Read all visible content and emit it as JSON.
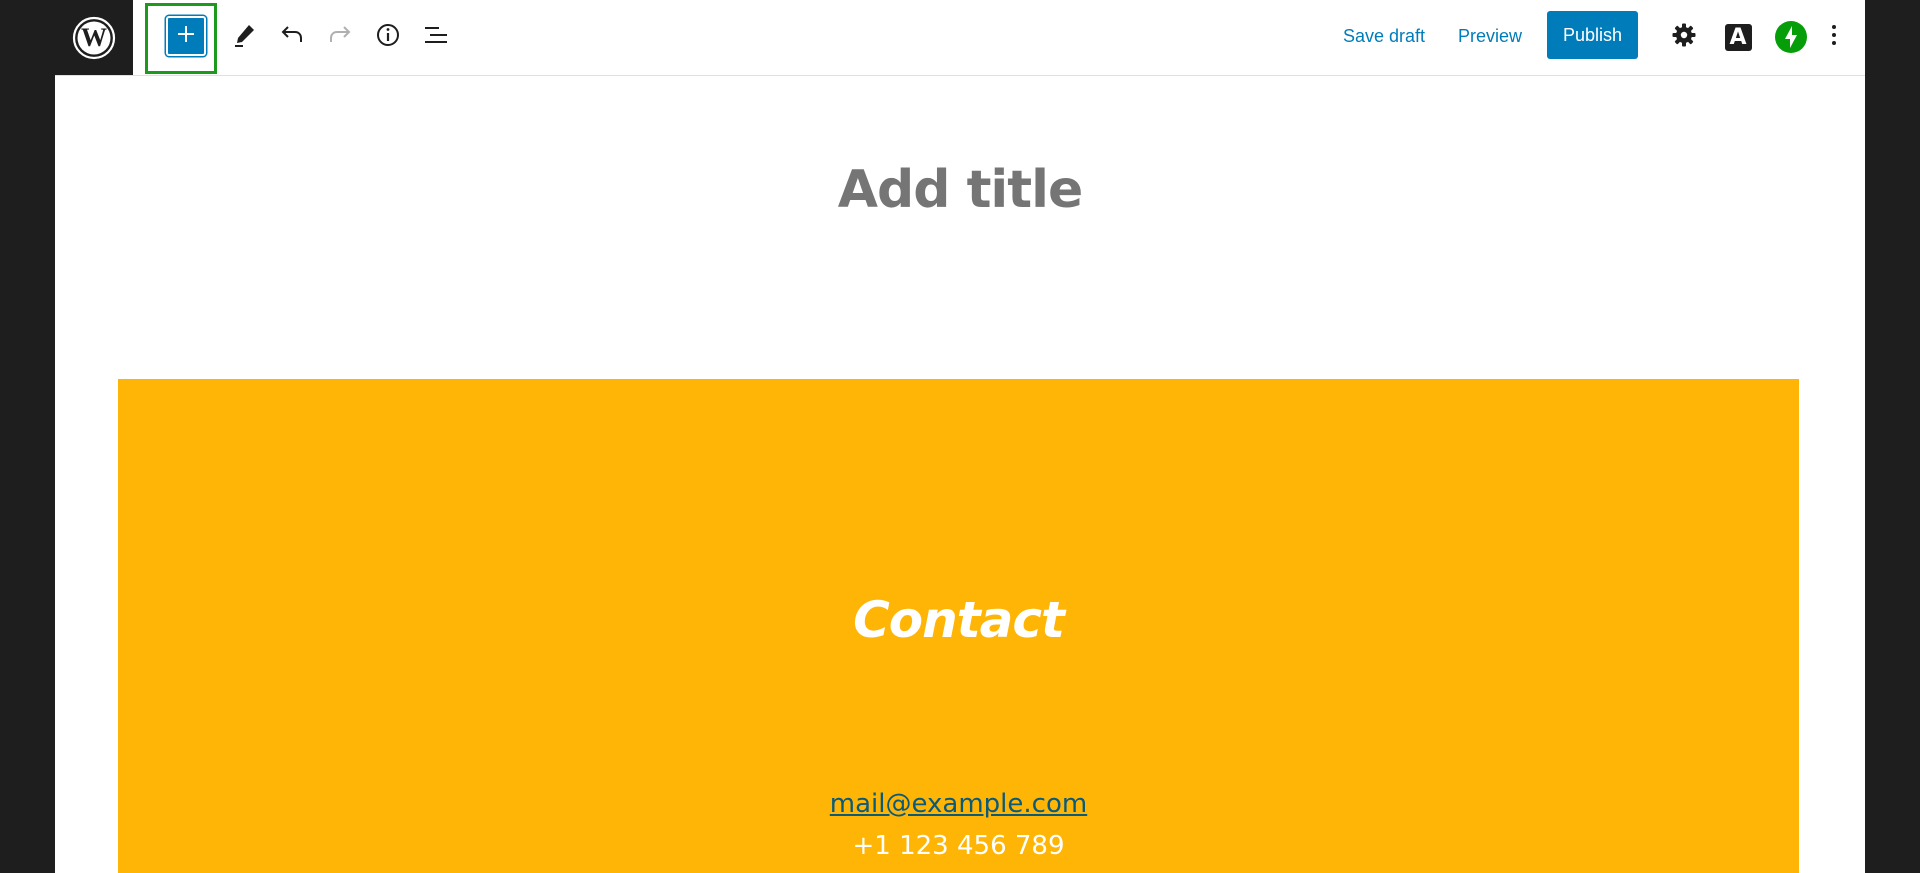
{
  "toolbar": {
    "add_block_label": "+",
    "save_draft_label": "Save draft",
    "preview_label": "Preview",
    "publish_label": "Publish",
    "astra_label": "A"
  },
  "icons": {
    "logo": "wordpress-logo-icon",
    "add": "plus-icon",
    "tools": "pencil-icon",
    "undo": "undo-icon",
    "redo": "redo-icon",
    "details": "info-icon",
    "outline": "list-view-icon",
    "settings": "gear-icon",
    "astra": "astra-icon",
    "jetpack": "jetpack-icon",
    "more": "more-vertical-icon"
  },
  "editor": {
    "title_placeholder": "Add title"
  },
  "cover": {
    "heading": "Contact",
    "email": "mail@example.com",
    "phone": "+1 123 456 789"
  },
  "colors": {
    "accent": "#007cba",
    "cover_background": "#ffb506",
    "focus_outline": "#1d9a1d",
    "jetpack": "#069e08"
  }
}
